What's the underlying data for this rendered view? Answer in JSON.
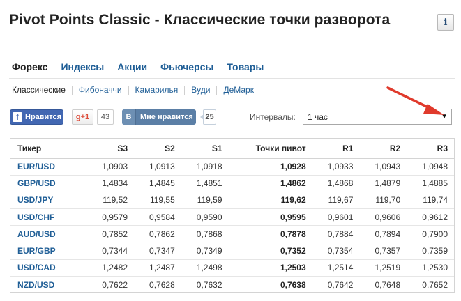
{
  "page": {
    "title": "Pivot Points Classic - Классические точки разворота",
    "info_glyph": "i"
  },
  "main_tabs": [
    {
      "label": "Форекс",
      "active": true
    },
    {
      "label": "Индексы",
      "active": false
    },
    {
      "label": "Акции",
      "active": false
    },
    {
      "label": "Фьючерсы",
      "active": false
    },
    {
      "label": "Товары",
      "active": false
    }
  ],
  "sub_tabs": [
    {
      "label": "Классические",
      "active": true
    },
    {
      "label": "Фибоначчи",
      "active": false
    },
    {
      "label": "Камарилья",
      "active": false
    },
    {
      "label": "Вуди",
      "active": false
    },
    {
      "label": "ДеМарк",
      "active": false
    }
  ],
  "social": {
    "fb_logo": "f",
    "fb_label": "Нравится",
    "gplus_label": "g+1",
    "gplus_count": "43",
    "vk_logo": "B",
    "vk_label": "Мне нравится",
    "vk_count": "25"
  },
  "intervals": {
    "label": "Интервалы:",
    "selected": "1 час",
    "arrow_glyph": "▼"
  },
  "table": {
    "columns": [
      "Тикер",
      "S3",
      "S2",
      "S1",
      "Точки пивот",
      "R1",
      "R2",
      "R3"
    ],
    "rows": [
      [
        "EUR/USD",
        "1,0903",
        "1,0913",
        "1,0918",
        "1,0928",
        "1,0933",
        "1,0943",
        "1,0948"
      ],
      [
        "GBP/USD",
        "1,4834",
        "1,4845",
        "1,4851",
        "1,4862",
        "1,4868",
        "1,4879",
        "1,4885"
      ],
      [
        "USD/JPY",
        "119,52",
        "119,55",
        "119,59",
        "119,62",
        "119,67",
        "119,70",
        "119,74"
      ],
      [
        "USD/CHF",
        "0,9579",
        "0,9584",
        "0,9590",
        "0,9595",
        "0,9601",
        "0,9606",
        "0,9612"
      ],
      [
        "AUD/USD",
        "0,7852",
        "0,7862",
        "0,7868",
        "0,7878",
        "0,7884",
        "0,7894",
        "0,7900"
      ],
      [
        "EUR/GBP",
        "0,7344",
        "0,7347",
        "0,7349",
        "0,7352",
        "0,7354",
        "0,7357",
        "0,7359"
      ],
      [
        "USD/CAD",
        "1,2482",
        "1,2487",
        "1,2498",
        "1,2503",
        "1,2514",
        "1,2519",
        "1,2530"
      ],
      [
        "NZD/USD",
        "0,7622",
        "0,7628",
        "0,7632",
        "0,7638",
        "0,7642",
        "0,7648",
        "0,7652"
      ]
    ]
  },
  "colors": {
    "link": "#1f5e96",
    "facebook": "#4267b2",
    "vk": "#5b7fa6",
    "annotation_arrow": "#e03a2c"
  }
}
